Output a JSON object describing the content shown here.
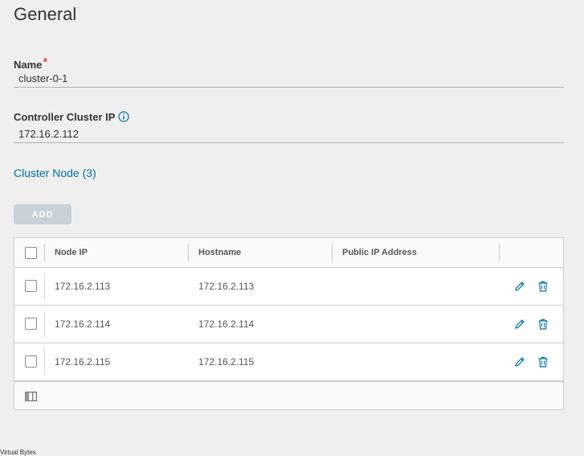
{
  "page": {
    "title": "General"
  },
  "name_field": {
    "label": "Name",
    "required_mark": "*",
    "value": "cluster-0-1"
  },
  "controller_ip_field": {
    "label": "Controller Cluster IP",
    "value": "172.16.2.112",
    "info_icon": "info-icon"
  },
  "cluster_node": {
    "section_title": "Cluster Node (3)",
    "add_label": "ADD",
    "columns": [
      "Node IP",
      "Hostname",
      "Public IP Address"
    ],
    "rows": [
      {
        "node_ip": "172.16.2.113",
        "hostname": "172.16.2.113",
        "public_ip": ""
      },
      {
        "node_ip": "172.16.2.114",
        "hostname": "172.16.2.114",
        "public_ip": ""
      },
      {
        "node_ip": "172.16.2.115",
        "hostname": "172.16.2.115",
        "public_ip": ""
      }
    ],
    "row_actions": [
      "edit-icon",
      "delete-icon"
    ],
    "footer_icon": "column-toggle-icon"
  },
  "watermark": "Virtual Bytes",
  "colors": {
    "link": "#0072a3",
    "required": "#c92100",
    "button_disabled": "#c8d2d8",
    "background": "#efefef"
  }
}
